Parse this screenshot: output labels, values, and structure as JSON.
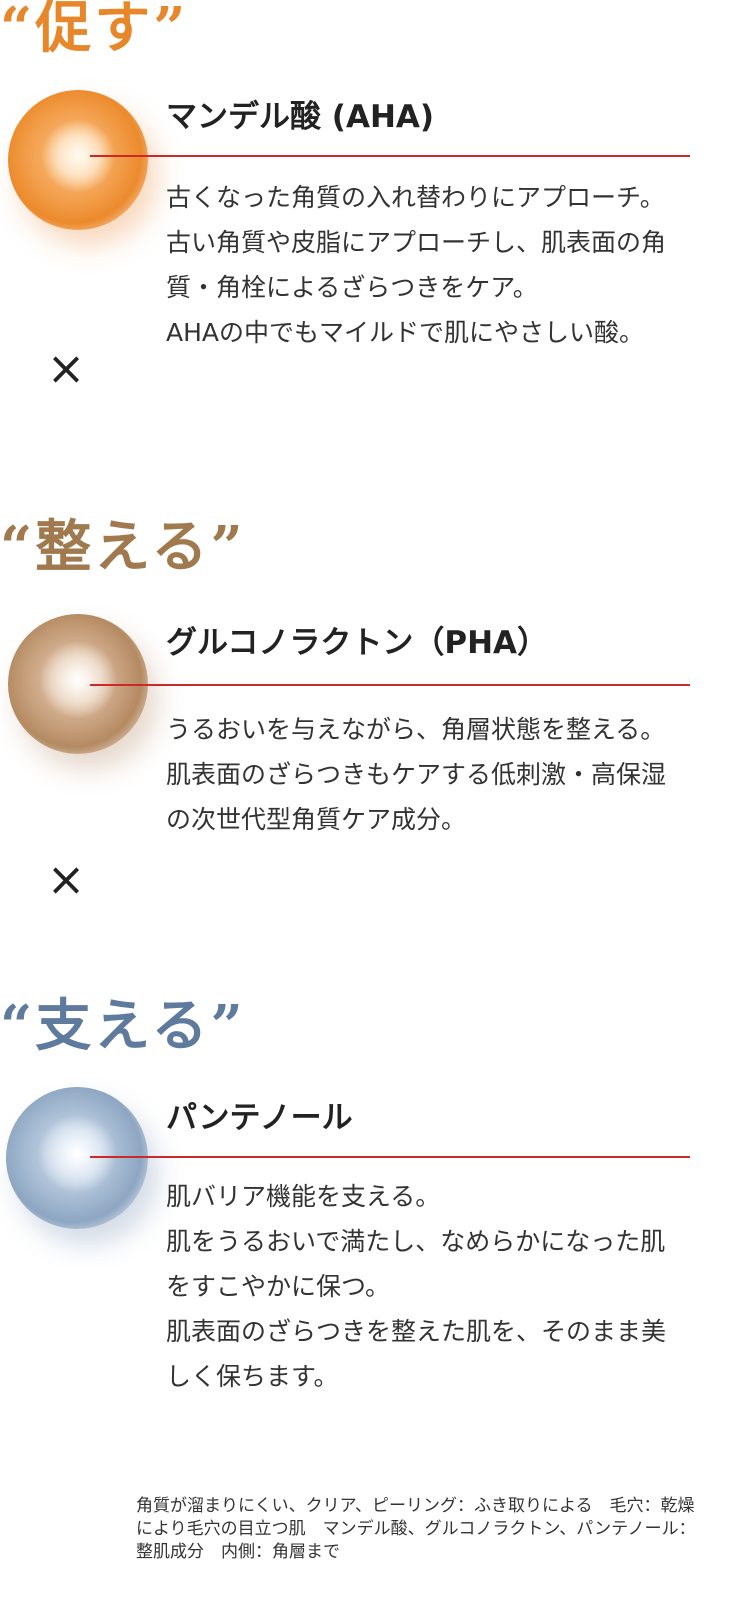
{
  "colors": {
    "heading_promote": "#e8872a",
    "heading_condition": "#a07a4e",
    "heading_support": "#5e7b9e",
    "accent_rule": "#cc2a2a"
  },
  "sections": [
    {
      "heading": "“促す”",
      "orb": "orange-sphere-image",
      "title": "マンデル酸 (AHA)",
      "lines": [
        "古くなった角質の入れ替わりにアプローチ。",
        "古い角質や皮脂にアプローチし、肌表面の角質・角栓によるざらつきをケア。",
        "AHAの中でもマイルドで肌にやさしい酸。"
      ],
      "connector": "×"
    },
    {
      "heading": "“整える”",
      "orb": "brown-sphere-image",
      "title": "グルコノラクトン（PHA）",
      "lines": [
        "うるおいを与えながら、角層状態を整える。",
        "肌表面のざらつきもケアする低刺激・高保湿の次世代型角質ケア成分。"
      ],
      "connector": "×"
    },
    {
      "heading": "“支える”",
      "orb": "blue-sphere-image",
      "title": "パンテノール",
      "lines": [
        "肌バリア機能を支える。",
        "肌をうるおいで満たし、なめらかになった肌をすこやかに保つ。",
        "肌表面のざらつきを整えた肌を、そのまま美しく保ちます。"
      ]
    }
  ],
  "footnote": "角質が溜まりにくい、クリア、ピーリング：ふき取りによる　毛穴：乾燥により毛穴の目立つ肌　マンデル酸、グルコノラクトン、パンテノール：整肌成分　内側：角層まで"
}
